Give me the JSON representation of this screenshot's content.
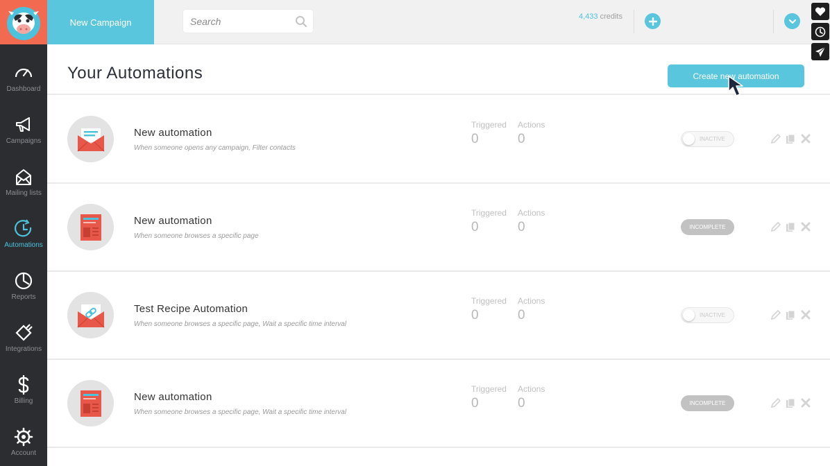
{
  "sidebar": {
    "items": [
      {
        "label": "Dashboard",
        "icon": "gauge-icon"
      },
      {
        "label": "Campaigns",
        "icon": "megaphone-icon"
      },
      {
        "label": "Mailing lists",
        "icon": "envelope-icon"
      },
      {
        "label": "Automations",
        "icon": "clock-refresh-icon",
        "active": true
      },
      {
        "label": "Reports",
        "icon": "pie-chart-icon"
      },
      {
        "label": "Integrations",
        "icon": "plug-icon"
      },
      {
        "label": "Billing",
        "icon": "dollar-icon"
      },
      {
        "label": "Account",
        "icon": "gear-icon"
      }
    ]
  },
  "topbar": {
    "new_campaign": "New Campaign",
    "search_placeholder": "Search",
    "credits_value": "4,433",
    "credits_label": "credits"
  },
  "main": {
    "title": "Your Automations",
    "create_button": "Create new automation",
    "stat_labels": {
      "triggered": "Triggered",
      "actions": "Actions"
    },
    "automations": [
      {
        "name": "New automation",
        "description": "When someone opens any campaign, Filter contacts",
        "triggered": "0",
        "actions": "0",
        "status": "INACTIVE",
        "icon": "open-envelope-icon"
      },
      {
        "name": "New automation",
        "description": "When someone browses a specific page",
        "triggered": "0",
        "actions": "0",
        "status": "INCOMPLETE",
        "icon": "web-page-icon"
      },
      {
        "name": "Test Recipe Automation",
        "description": "When someone browses a specific page, Wait a specific time interval",
        "triggered": "0",
        "actions": "0",
        "status": "INACTIVE",
        "icon": "link-envelope-icon"
      },
      {
        "name": "New automation",
        "description": "When someone browses a specific page, Wait a specific time interval",
        "triggered": "0",
        "actions": "0",
        "status": "INCOMPLETE",
        "icon": "web-page-icon"
      }
    ]
  },
  "colors": {
    "accent": "#59c6dd",
    "logo_bg": "#f26b50",
    "sidebar_bg": "#2b2d30",
    "icon_red": "#e8584a"
  }
}
